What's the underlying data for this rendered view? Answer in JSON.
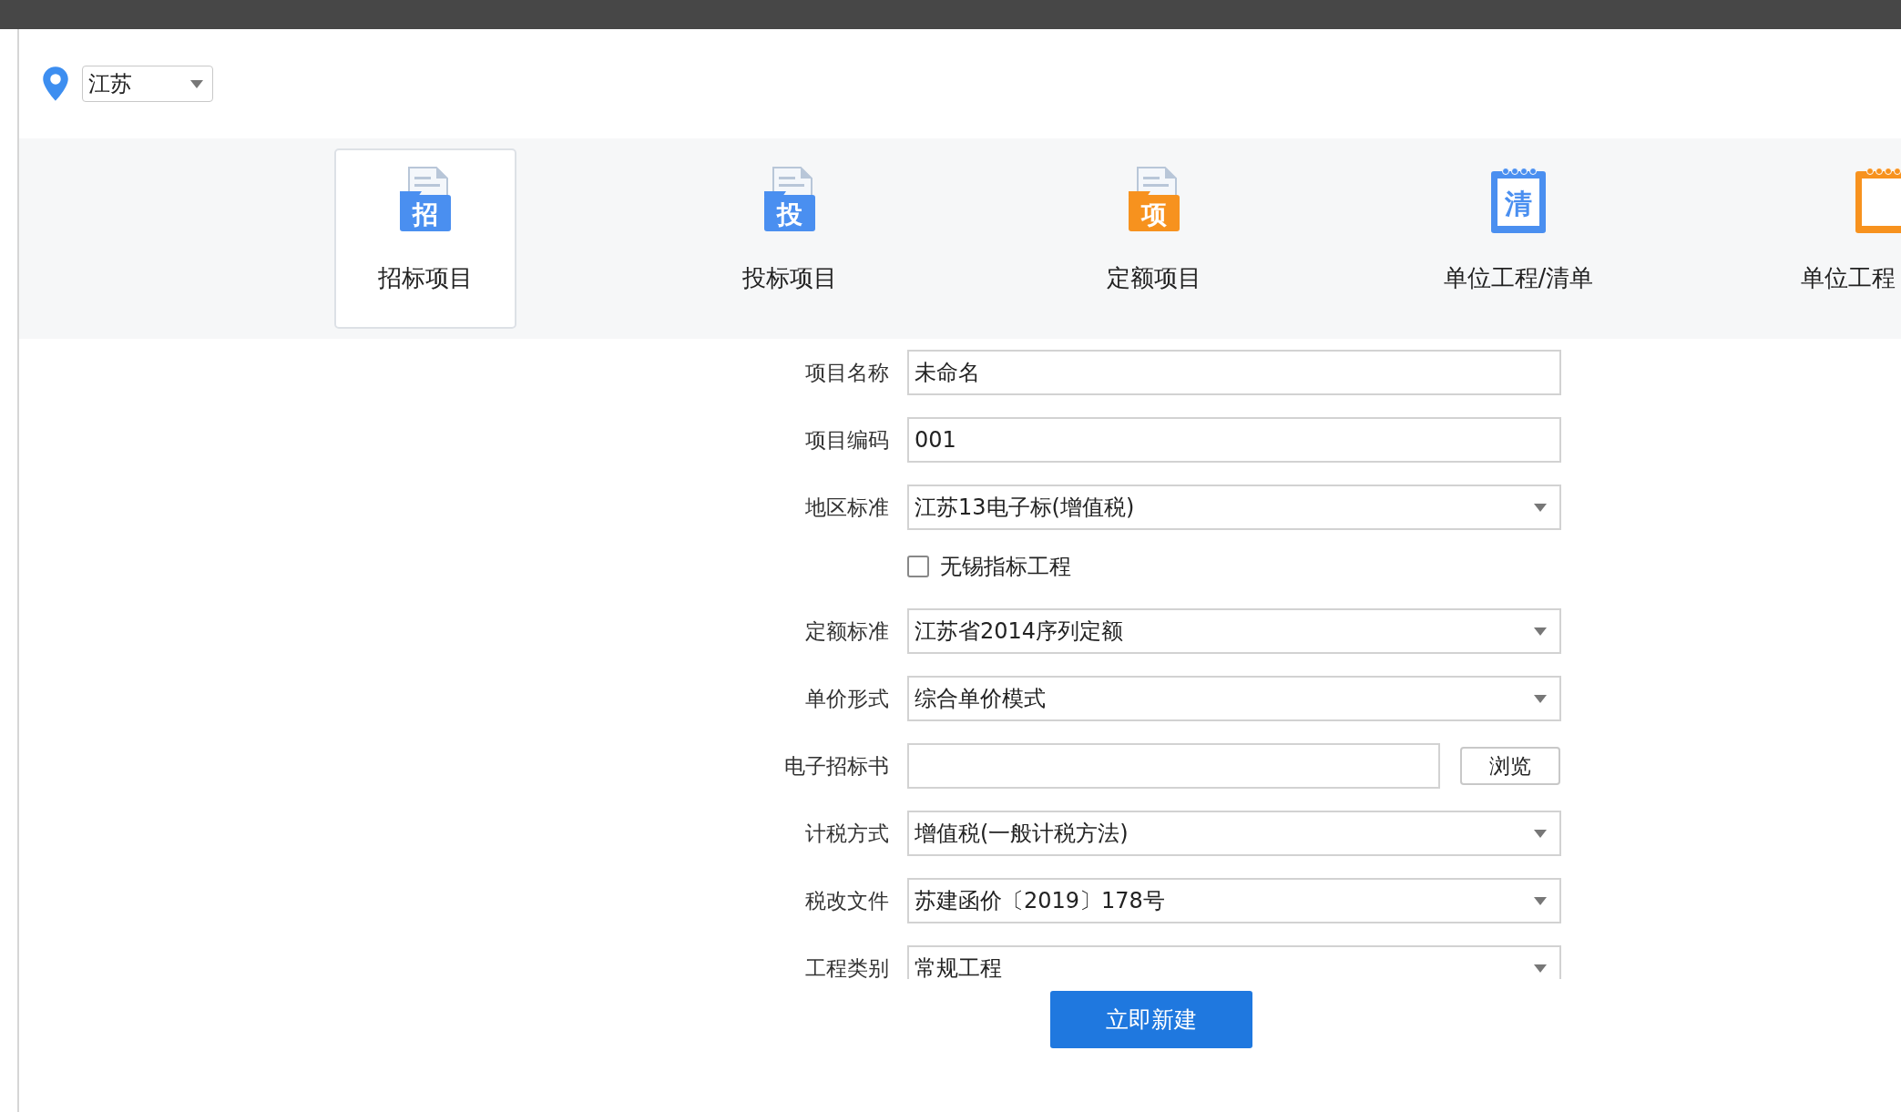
{
  "region_select": {
    "value": "江苏"
  },
  "tabs": [
    {
      "label": "招标项目",
      "selected": true,
      "kind": "folder",
      "color": "#4a8ff0",
      "glyph": "招"
    },
    {
      "label": "投标项目",
      "selected": false,
      "kind": "folder",
      "color": "#4a8ff0",
      "glyph": "投"
    },
    {
      "label": "定额项目",
      "selected": false,
      "kind": "folder",
      "color": "#f7921e",
      "glyph": "项"
    },
    {
      "label": "单位工程/清单",
      "selected": false,
      "kind": "notebook",
      "color": "#4a8ff0",
      "glyph": "清"
    },
    {
      "label": "单位工程",
      "selected": false,
      "kind": "notebook",
      "color": "#f7921e"
    }
  ],
  "form": {
    "rows": [
      {
        "kind": "text",
        "label": "项目名称",
        "value": "未命名"
      },
      {
        "kind": "text",
        "label": "项目编码",
        "value": "001"
      },
      {
        "kind": "select",
        "label": "地区标准",
        "value": "江苏13电子标(增值税)"
      },
      {
        "kind": "checkbox",
        "label": "无锡指标工程",
        "checked": false
      },
      {
        "kind": "select",
        "label": "定额标准",
        "value": "江苏省2014序列定额"
      },
      {
        "kind": "select",
        "label": "单价形式",
        "value": "综合单价模式"
      },
      {
        "kind": "file",
        "label": "电子招标书",
        "button": "浏览"
      },
      {
        "kind": "select",
        "label": "计税方式",
        "value": "增值税(一般计税方法)"
      },
      {
        "kind": "select",
        "label": "税改文件",
        "value": "苏建函价〔2019〕178号"
      },
      {
        "kind": "select",
        "label": "工程类别",
        "value": "常规工程"
      }
    ],
    "submit": "立即新建"
  }
}
